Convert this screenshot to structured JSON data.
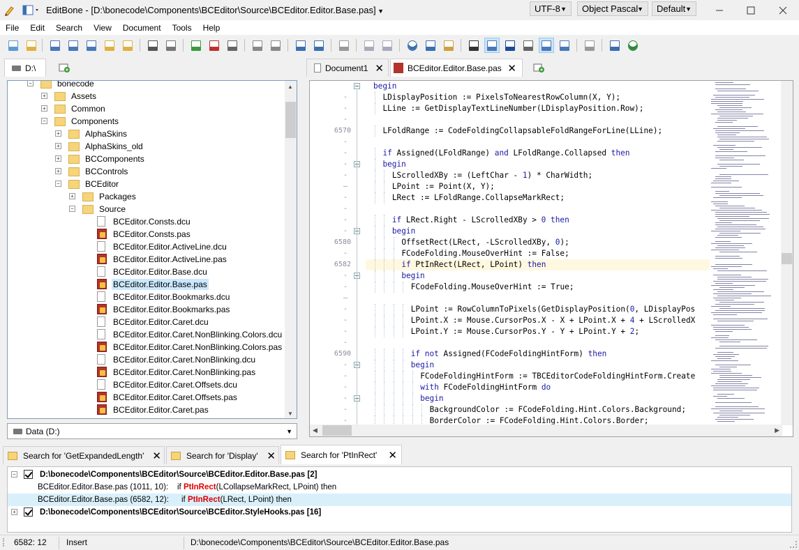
{
  "window": {
    "app_name": "EditBone",
    "title_sep": " - ",
    "file_path": "[D:\\bonecode\\Components\\BCEditor\\Source\\BCEditor.Editor.Base.pas]",
    "encoding": "UTF-8",
    "language": "Object Pascal",
    "theme": "Default"
  },
  "menu": [
    "File",
    "Edit",
    "Search",
    "View",
    "Document",
    "Tools",
    "Help"
  ],
  "left_panel": {
    "drive_tab": "D:\\",
    "drive_selector": "Data (D:)",
    "tree": [
      {
        "label": "bonecode",
        "level": 0,
        "kind": "folder",
        "expanded": true
      },
      {
        "label": "Assets",
        "level": 1,
        "kind": "folder",
        "expanded": false
      },
      {
        "label": "Common",
        "level": 1,
        "kind": "folder",
        "expanded": false
      },
      {
        "label": "Components",
        "level": 1,
        "kind": "folder",
        "expanded": true
      },
      {
        "label": "AlphaSkins",
        "level": 2,
        "kind": "folder",
        "expanded": false
      },
      {
        "label": "AlphaSkins_old",
        "level": 2,
        "kind": "folder",
        "expanded": false
      },
      {
        "label": "BCComponents",
        "level": 2,
        "kind": "folder",
        "expanded": false
      },
      {
        "label": "BCControls",
        "level": 2,
        "kind": "folder",
        "expanded": false
      },
      {
        "label": "BCEditor",
        "level": 2,
        "kind": "folder",
        "expanded": true
      },
      {
        "label": "Packages",
        "level": 3,
        "kind": "folder",
        "expanded": false
      },
      {
        "label": "Source",
        "level": 3,
        "kind": "folder",
        "expanded": true
      },
      {
        "label": "BCEditor.Consts.dcu",
        "level": 4,
        "kind": "dcu"
      },
      {
        "label": "BCEditor.Consts.pas",
        "level": 4,
        "kind": "pas"
      },
      {
        "label": "BCEditor.Editor.ActiveLine.dcu",
        "level": 4,
        "kind": "dcu"
      },
      {
        "label": "BCEditor.Editor.ActiveLine.pas",
        "level": 4,
        "kind": "pas"
      },
      {
        "label": "BCEditor.Editor.Base.dcu",
        "level": 4,
        "kind": "dcu"
      },
      {
        "label": "BCEditor.Editor.Base.pas",
        "level": 4,
        "kind": "pas",
        "selected": true
      },
      {
        "label": "BCEditor.Editor.Bookmarks.dcu",
        "level": 4,
        "kind": "dcu"
      },
      {
        "label": "BCEditor.Editor.Bookmarks.pas",
        "level": 4,
        "kind": "pas"
      },
      {
        "label": "BCEditor.Editor.Caret.dcu",
        "level": 4,
        "kind": "dcu"
      },
      {
        "label": "BCEditor.Editor.Caret.NonBlinking.Colors.dcu",
        "level": 4,
        "kind": "dcu"
      },
      {
        "label": "BCEditor.Editor.Caret.NonBlinking.Colors.pas",
        "level": 4,
        "kind": "pas"
      },
      {
        "label": "BCEditor.Editor.Caret.NonBlinking.dcu",
        "level": 4,
        "kind": "dcu"
      },
      {
        "label": "BCEditor.Editor.Caret.NonBlinking.pas",
        "level": 4,
        "kind": "pas"
      },
      {
        "label": "BCEditor.Editor.Caret.Offsets.dcu",
        "level": 4,
        "kind": "dcu"
      },
      {
        "label": "BCEditor.Editor.Caret.Offsets.pas",
        "level": 4,
        "kind": "pas"
      },
      {
        "label": "BCEditor.Editor.Caret.pas",
        "level": 4,
        "kind": "pas"
      }
    ]
  },
  "editor": {
    "tabs": [
      {
        "label": "Document1",
        "active": false
      },
      {
        "label": "BCEditor.Editor.Base.pas",
        "active": true
      }
    ],
    "gutter": [
      {
        "n": "",
        "fold": true
      },
      {
        "n": "-"
      },
      {
        "n": "-"
      },
      {
        "n": "-"
      },
      {
        "n": "6570"
      },
      {
        "n": "-"
      },
      {
        "n": "-"
      },
      {
        "n": "-",
        "fold": true
      },
      {
        "n": "-"
      },
      {
        "n": "–"
      },
      {
        "n": "-"
      },
      {
        "n": "-"
      },
      {
        "n": "-"
      },
      {
        "n": "-",
        "fold": true
      },
      {
        "n": "6580"
      },
      {
        "n": "-"
      },
      {
        "n": "6582"
      },
      {
        "n": "-",
        "fold": true
      },
      {
        "n": "-"
      },
      {
        "n": "–"
      },
      {
        "n": "-"
      },
      {
        "n": "-"
      },
      {
        "n": "-"
      },
      {
        "n": "-"
      },
      {
        "n": "6590"
      },
      {
        "n": "-",
        "fold": true
      },
      {
        "n": "-"
      },
      {
        "n": "-"
      },
      {
        "n": "-",
        "fold": true
      },
      {
        "n": "-"
      },
      {
        "n": "-"
      }
    ],
    "current_line_index": 16,
    "lines": [
      {
        "indent": 0,
        "text": "begin"
      },
      {
        "indent": 1,
        "text": "LDisplayPosition := PixelsToNearestRowColumn(X, Y);"
      },
      {
        "indent": 1,
        "text": "LLine := GetDisplayTextLineNumber(LDisplayPosition.Row);"
      },
      {
        "indent": 0,
        "text": ""
      },
      {
        "indent": 1,
        "text": "LFoldRange := CodeFoldingCollapsableFoldRangeForLine(LLine);"
      },
      {
        "indent": 0,
        "text": ""
      },
      {
        "indent": 1,
        "text": "if Assigned(LFoldRange) and LFoldRange.Collapsed then"
      },
      {
        "indent": 1,
        "text": "begin"
      },
      {
        "indent": 2,
        "text": "LScrolledXBy := (LeftChar - 1) * CharWidth;"
      },
      {
        "indent": 2,
        "text": "LPoint := Point(X, Y);"
      },
      {
        "indent": 2,
        "text": "LRect := LFoldRange.CollapseMarkRect;"
      },
      {
        "indent": 0,
        "text": ""
      },
      {
        "indent": 2,
        "text": "if LRect.Right - LScrolledXBy > 0 then"
      },
      {
        "indent": 2,
        "text": "begin"
      },
      {
        "indent": 3,
        "text": "OffsetRect(LRect, -LScrolledXBy, 0);"
      },
      {
        "indent": 3,
        "text": "FCodeFolding.MouseOverHint := False;"
      },
      {
        "indent": 3,
        "text": "if PtInRect(LRect, LPoint) then"
      },
      {
        "indent": 3,
        "text": "begin"
      },
      {
        "indent": 4,
        "text": "FCodeFolding.MouseOverHint := True;"
      },
      {
        "indent": 0,
        "text": ""
      },
      {
        "indent": 4,
        "text": "LPoint := RowColumnToPixels(GetDisplayPosition(0, LDisplayPos"
      },
      {
        "indent": 4,
        "text": "LPoint.X := Mouse.CursorPos.X - X + LPoint.X + 4 + LScrolledX"
      },
      {
        "indent": 4,
        "text": "LPoint.Y := Mouse.CursorPos.Y - Y + LPoint.Y + 2;"
      },
      {
        "indent": 0,
        "text": ""
      },
      {
        "indent": 4,
        "text": "if not Assigned(FCodeFoldingHintForm) then"
      },
      {
        "indent": 4,
        "text": "begin"
      },
      {
        "indent": 5,
        "text": "FCodeFoldingHintForm := TBCEditorCodeFoldingHintForm.Create"
      },
      {
        "indent": 5,
        "text": "with FCodeFoldingHintForm do"
      },
      {
        "indent": 5,
        "text": "begin"
      },
      {
        "indent": 6,
        "text": "BackgroundColor := FCodeFolding.Hint.Colors.Background;"
      },
      {
        "indent": 6,
        "text": "BorderColor := FCodeFolding.Hint.Colors.Border;"
      }
    ]
  },
  "search": {
    "tabs": [
      {
        "label": "Search for 'GetExpandedLength'",
        "active": false
      },
      {
        "label": "Search for 'Display'",
        "active": false
      },
      {
        "label": "Search for 'PtInRect'",
        "active": true
      }
    ],
    "results": [
      {
        "type": "file",
        "expanded": true,
        "checked": true,
        "text": "D:\\bonecode\\Components\\BCEditor\\Source\\BCEditor.Editor.Base.pas [2]"
      },
      {
        "type": "hit",
        "location": "BCEditor.Editor.Base.pas (1011, 10):",
        "before": "if ",
        "match": "PtInRect",
        "after": "(LCollapseMarkRect, LPoint) then",
        "selected": false
      },
      {
        "type": "hit",
        "location": "BCEditor.Editor.Base.pas (6582, 12):",
        "before": "if ",
        "match": "PtInRect",
        "after": "(LRect, LPoint) then",
        "selected": true
      },
      {
        "type": "file",
        "expanded": false,
        "checked": true,
        "text": "D:\\bonecode\\Components\\BCEditor\\Source\\BCEditor.StyleHooks.pas [16]"
      }
    ]
  },
  "status": {
    "position": "6582: 12",
    "mode": "Insert",
    "path": "D:\\bonecode\\Components\\BCEditor\\Source\\BCEditor.Editor.Base.pas"
  },
  "colors": {
    "keyword": "#1a1aa6",
    "match": "#e00000",
    "selection": "#cce8ff",
    "current_line": "#fff8e0"
  },
  "icons": {
    "toolbar": [
      "new-file-icon",
      "new-folder-icon",
      "save-icon",
      "save-as-icon",
      "save-all-icon",
      "open-icon",
      "open-folder-icon",
      "print-icon",
      "print-preview-icon",
      "add-icon",
      "remove-icon",
      "edit-icon",
      "indent-icon",
      "outdent-icon",
      "sort-asc-icon",
      "sort-desc-icon",
      "format-icon",
      "undo-icon",
      "redo-icon",
      "search-icon",
      "replace-icon",
      "search-folder-icon",
      "case-icon",
      "word-wrap-icon",
      "pilcrow-icon",
      "selection-icon",
      "split-view-icon",
      "ruler-icon",
      "compare-icon",
      "document-info-icon",
      "globe-icon"
    ]
  }
}
